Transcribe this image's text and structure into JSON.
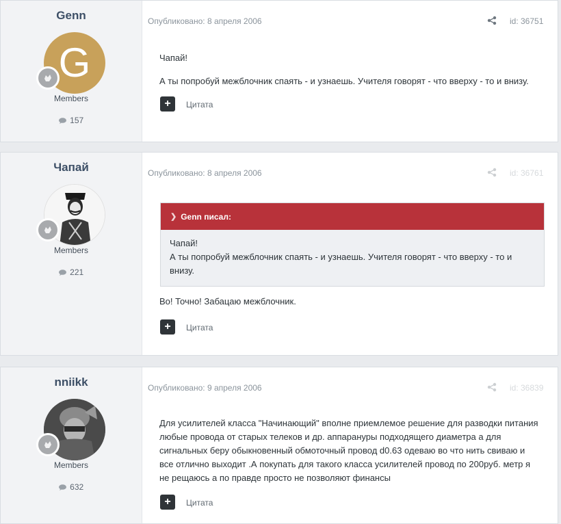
{
  "posts": [
    {
      "author": "Genn",
      "group": "Members",
      "post_count": "157",
      "published": "Опубликовано: 8 апреля 2006",
      "post_id": "id: 36751",
      "avatar_letter": "G",
      "avatar_color": "#c8a15a",
      "body": [
        "Чапай!",
        "А ты попробуй межблочник спаять - и узнаешь. Учителя говорят - что вверху - то и внизу."
      ],
      "quote_action": "Цитата"
    },
    {
      "author": "Чапай",
      "group": "Members",
      "post_count": "221",
      "published": "Опубликовано: 8 апреля 2006",
      "post_id": "id: 36761",
      "quote": {
        "header": "Genn писал:",
        "lines": [
          "Чапай!",
          "А ты попробуй межблочник спаять - и узнаешь. Учителя говорят - что вверху - то и",
          "внизу."
        ]
      },
      "body": [
        "Во! Точно! Забацаю межблочник."
      ],
      "quote_action": "Цитата"
    },
    {
      "author": "nniikk",
      "group": "Members",
      "post_count": "632",
      "published": "Опубликовано: 9 апреля 2006",
      "post_id": "id: 36839",
      "body": [
        "Для усилителей класса \"Начинающий\" вполне приемлемое решение для разводки питания",
        "любые провода от старых телеков и др. аппарануры подходящего диаметра а для",
        "сигнальных беру обыкновенный обмоточный провод d0.63 одеваю во что нить свиваю и",
        "все отлично выходит .А покупать для такого класса усилителей провод по 200руб. метр я",
        "не рещаюсь а по правде просто не позволяют финансы"
      ],
      "quote_action": "Цитата"
    }
  ],
  "icons": {
    "share": "share-icon",
    "comment": "comment-icon",
    "rank": "rank-badge-icon",
    "plus": "plus-icon",
    "chevron": "chevron-down-icon"
  },
  "colors": {
    "quote_header": "#b8323a",
    "author_name": "#3d4f66",
    "avatar_genn": "#c8a15a"
  }
}
